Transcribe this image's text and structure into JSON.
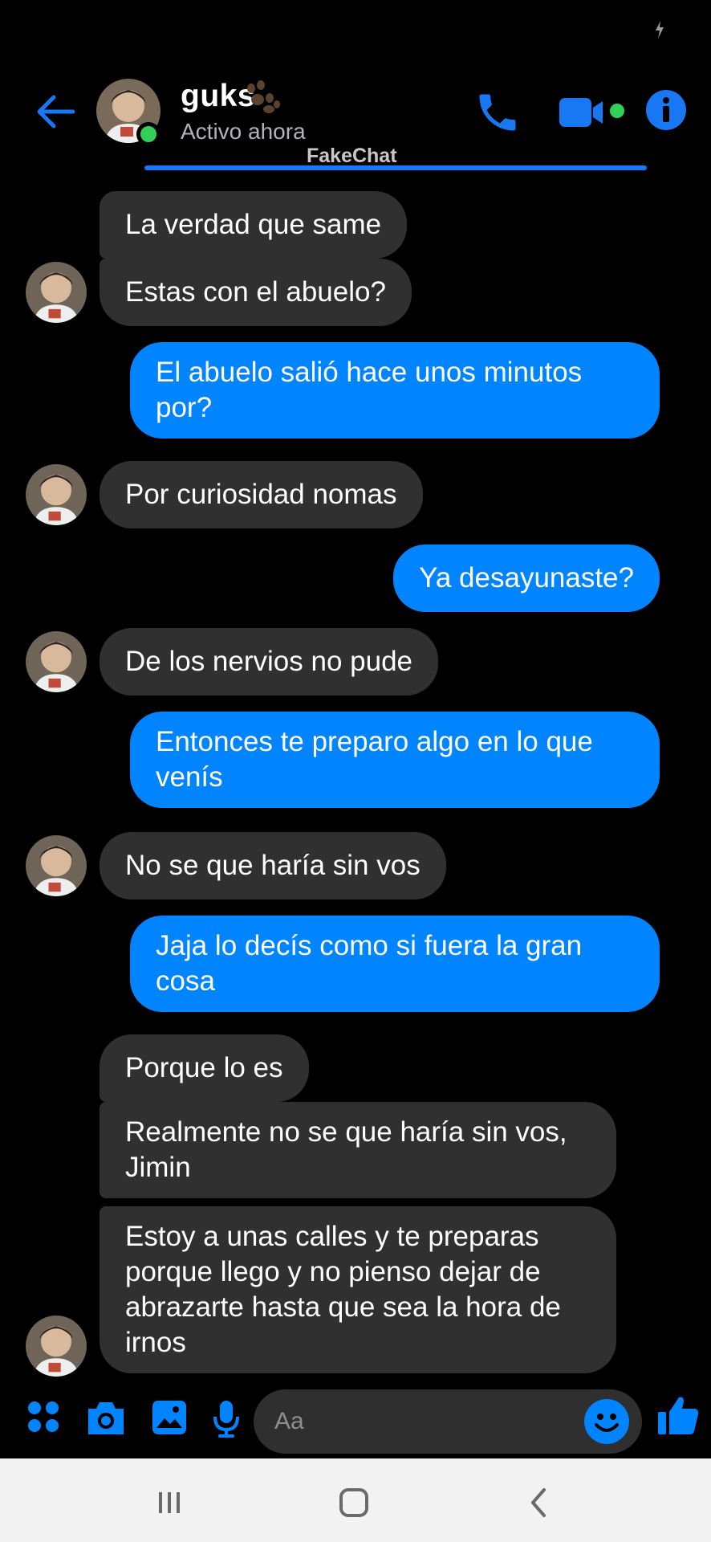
{
  "header": {
    "contact_name": "guks",
    "status": "Activo ahora",
    "watermark": "FakeChat"
  },
  "messages": [
    {
      "side": "in",
      "text": "La verdad que same"
    },
    {
      "side": "in",
      "text": "Estas con el abuelo?"
    },
    {
      "side": "out",
      "lines": [
        "El abuelo salió hace unos minutos",
        "por?"
      ]
    },
    {
      "side": "in",
      "text": "Por curiosidad nomas"
    },
    {
      "side": "out",
      "text": "Ya desayunaste?"
    },
    {
      "side": "in",
      "text": "De los nervios no pude"
    },
    {
      "side": "out",
      "lines": [
        "Entonces te preparo algo en lo que",
        "venís"
      ]
    },
    {
      "side": "in",
      "text": "No se que haría sin vos"
    },
    {
      "side": "out",
      "lines": [
        "Jaja lo decís como si fuera la gran",
        "cosa"
      ]
    },
    {
      "side": "in",
      "text": "Porque lo es"
    },
    {
      "side": "in",
      "lines": [
        "Realmente no se que haría sin vos,",
        "Jimin"
      ]
    },
    {
      "side": "in",
      "lines": [
        "Estoy a unas calles y te preparas",
        "porque llego y no pienso dejar de",
        "abrazarte hasta que sea la hora de",
        "irnos"
      ]
    }
  ],
  "composer": {
    "placeholder": "Aa",
    "icons": [
      "apps-icon",
      "camera-icon",
      "gallery-icon",
      "microphone-icon",
      "emoji-icon",
      "like-icon"
    ]
  },
  "colors": {
    "accent": "#0084ff",
    "incoming_bubble": "#303030",
    "online": "#31d158",
    "background": "#000000"
  }
}
